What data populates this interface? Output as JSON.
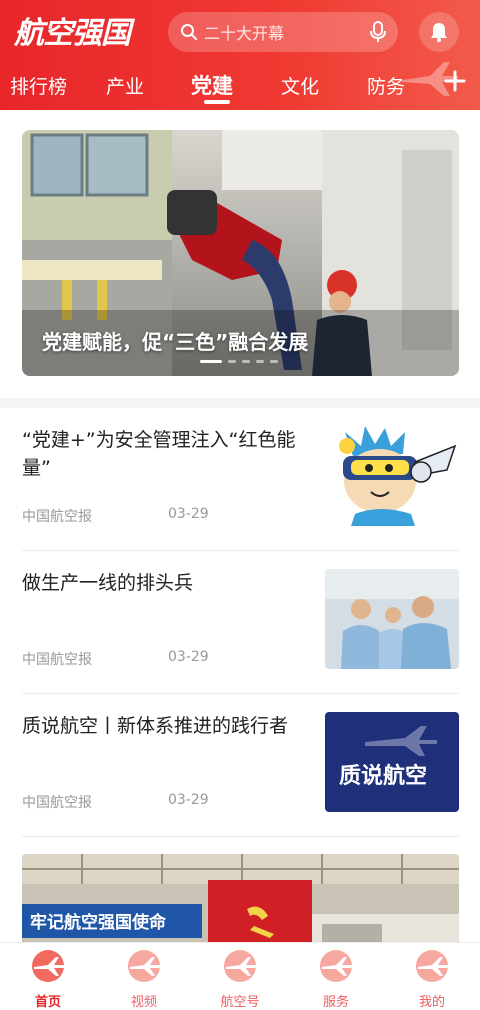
{
  "header": {
    "logo_text": "航空强国",
    "search_placeholder": "二十大开幕",
    "icons": {
      "search": "search-icon",
      "mic": "microphone-icon",
      "bell": "bell-icon",
      "plus": "plus-icon"
    }
  },
  "tabs": [
    {
      "label": "排行榜"
    },
    {
      "label": "产业"
    },
    {
      "label": "党建"
    },
    {
      "label": "文化"
    },
    {
      "label": "防务"
    }
  ],
  "active_tab": "党建",
  "banner": {
    "title": "党建赋能，促“三色”融合发展",
    "slides": 5,
    "active_slide": 1
  },
  "news": [
    {
      "title": "“党建+”为安全管理注入“红色能量”",
      "source": "中国航空报",
      "date": "03-29",
      "thumb": "cartoon-mascot"
    },
    {
      "title": "做生产一线的排头兵",
      "source": "中国航空报",
      "date": "03-29",
      "thumb": "workers-photo"
    },
    {
      "title": "质说航空丨新体系推进的践行者",
      "source": "中国航空报",
      "date": "03-29",
      "thumb": "zhishuo-hangkong-cover",
      "thumb_text": "质说航空"
    }
  ],
  "big_image": {
    "banner_text": "牢记航空强国使命"
  },
  "bottom_nav": [
    {
      "label": "首页",
      "active": true
    },
    {
      "label": "视频",
      "active": false
    },
    {
      "label": "航空号",
      "active": false
    },
    {
      "label": "服务",
      "active": false
    },
    {
      "label": "我的",
      "active": false
    }
  ],
  "colors": {
    "brand_red": "#e8262a",
    "text_dark": "#222222",
    "text_meta": "#999999"
  }
}
